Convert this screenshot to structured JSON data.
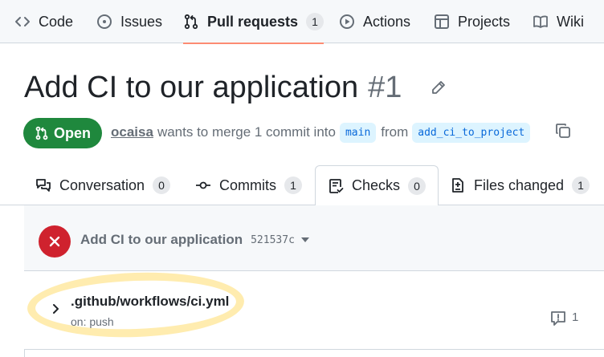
{
  "repo_nav": {
    "items": [
      {
        "label": "Code",
        "icon": "code-icon"
      },
      {
        "label": "Issues",
        "icon": "issue-opened-icon"
      },
      {
        "label": "Pull requests",
        "icon": "git-pull-request-icon",
        "count": "1",
        "selected": true
      },
      {
        "label": "Actions",
        "icon": "play-icon"
      },
      {
        "label": "Projects",
        "icon": "table-icon"
      },
      {
        "label": "Wiki",
        "icon": "book-icon"
      }
    ]
  },
  "pr": {
    "title": "Add CI to our application",
    "number": "#1",
    "state": "Open",
    "author": "ocaisa",
    "merge_text": "wants to merge 1 commit into",
    "base_branch": "main",
    "from_text": "from",
    "head_branch": "add_ci_to_project"
  },
  "tabs": [
    {
      "label": "Conversation",
      "count": "0",
      "icon": "comment-discussion-icon"
    },
    {
      "label": "Commits",
      "count": "1",
      "icon": "git-commit-icon"
    },
    {
      "label": "Checks",
      "count": "0",
      "icon": "checklist-icon",
      "selected": true
    },
    {
      "label": "Files changed",
      "count": "1",
      "icon": "file-diff-icon"
    }
  ],
  "checks": {
    "run_title": "Add CI to our application",
    "run_sha": "521537c",
    "status": "failure",
    "workflow": {
      "name": ".github/workflows/ci.yml",
      "trigger": "on: push",
      "annotations": "1"
    }
  },
  "colors": {
    "open_green": "#1f883d",
    "fail_red": "#cf222e",
    "accent_orange": "#fd8c73",
    "link_blue": "#0969da",
    "highlight_yellow": "#ffdc6e"
  }
}
